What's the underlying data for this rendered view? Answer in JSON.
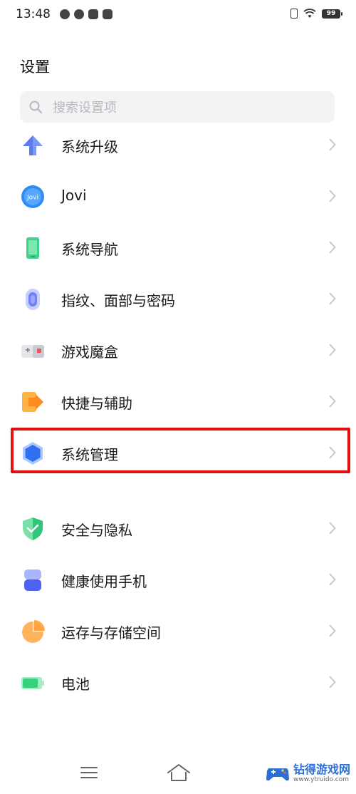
{
  "status_bar": {
    "time": "13:48",
    "battery": "99",
    "notification_icons": [
      "wechat-icon",
      "compass-icon",
      "mail-icon",
      "video-icon"
    ]
  },
  "header": {
    "title": "设置"
  },
  "search": {
    "placeholder": "搜索设置项",
    "value": ""
  },
  "settings_items": [
    {
      "label": "系统升级",
      "icon": "arrow-up-icon"
    },
    {
      "label": "Jovi",
      "icon": "jovi-icon"
    },
    {
      "label": "系统导航",
      "icon": "phone-navigation-icon"
    },
    {
      "label": "指纹、面部与密码",
      "icon": "fingerprint-icon"
    },
    {
      "label": "游戏魔盒",
      "icon": "game-box-icon"
    },
    {
      "label": "快捷与辅助",
      "icon": "shortcut-icon"
    },
    {
      "label": "系统管理",
      "icon": "hexagon-icon"
    },
    {
      "label": "安全与隐私",
      "icon": "shield-icon"
    },
    {
      "label": "健康使用手机",
      "icon": "hourglass-icon"
    },
    {
      "label": "运存与存储空间",
      "icon": "pie-storage-icon"
    },
    {
      "label": "电池",
      "icon": "battery-icon"
    }
  ],
  "highlighted_item": "系统管理",
  "watermark": {
    "title": "钻得游戏网",
    "url": "www.ytruido.com"
  },
  "colors": {
    "highlight": "#e01010",
    "accent_blue": "#3b82f6",
    "search_bg": "#f3f3f5"
  }
}
